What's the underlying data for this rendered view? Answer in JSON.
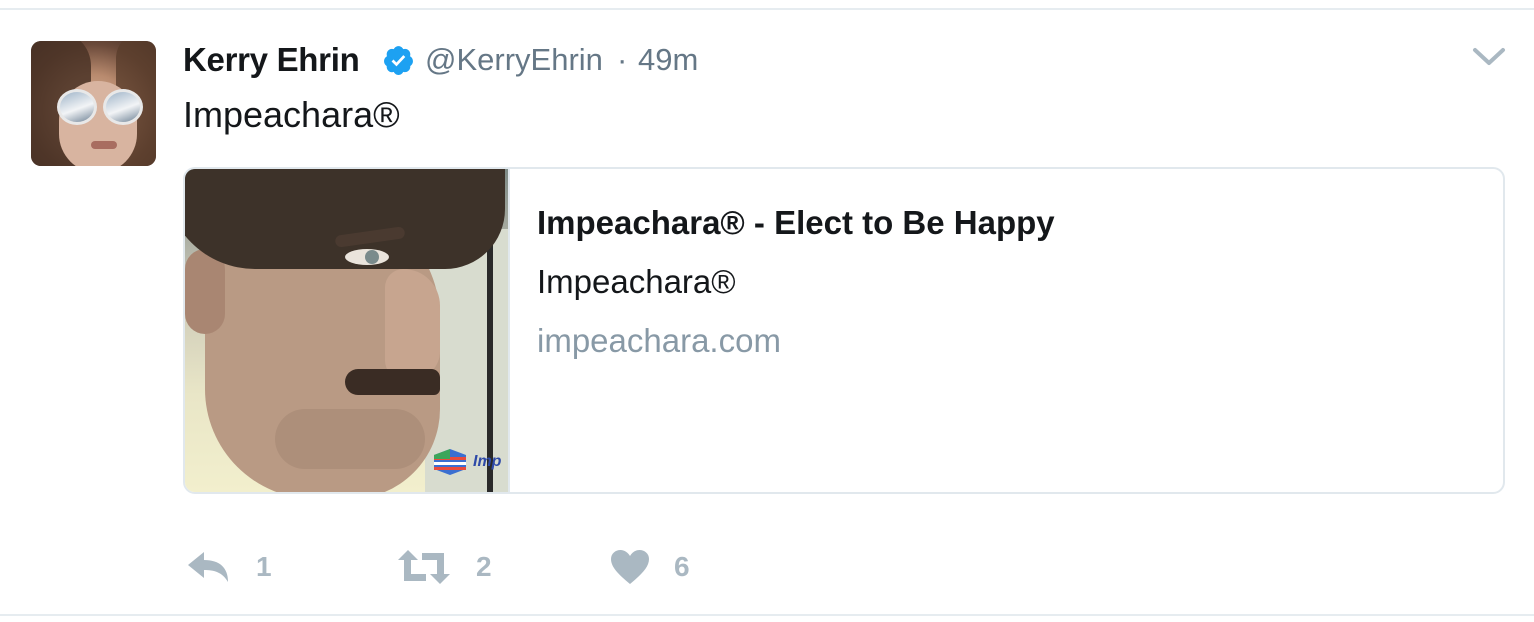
{
  "tweet": {
    "author": {
      "name": "Kerry Ehrin",
      "handle": "@KerryEhrin",
      "verified": true
    },
    "separator": "·",
    "time": "49m",
    "text": "Impeachara®",
    "card": {
      "title": "Impeachara® - Elect to Be Happy",
      "description": "Impeachara®",
      "domain": "impeachara.com",
      "image_logo_text": "Imp"
    },
    "actions": {
      "replies": "1",
      "retweets": "2",
      "likes": "6"
    }
  },
  "colors": {
    "text_primary": "#14171a",
    "text_secondary": "#657786",
    "url_gray": "#8899a6",
    "action_gray": "#aab8c2",
    "verified_blue": "#1da1f2",
    "border": "#e1e8ed"
  },
  "icons": [
    "verified-badge-icon",
    "chevron-down-icon",
    "reply-icon",
    "retweet-icon",
    "heart-icon"
  ]
}
